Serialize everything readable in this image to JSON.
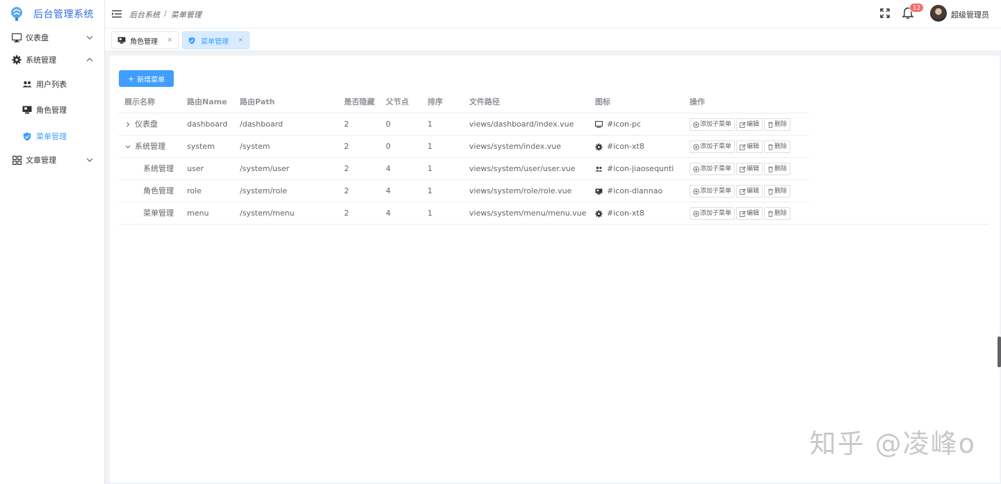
{
  "app": {
    "title": "后台管理系统"
  },
  "sidebar": {
    "items": [
      {
        "label": "仪表盘",
        "icon": "monitor-icon"
      },
      {
        "label": "系统管理",
        "icon": "gear-icon"
      },
      {
        "label": "文章管理",
        "icon": "grid-icon"
      }
    ],
    "subitems": [
      {
        "label": "用户列表",
        "icon": "users-icon"
      },
      {
        "label": "角色管理",
        "icon": "computer-icon"
      },
      {
        "label": "菜单管理",
        "icon": "shield-icon",
        "active": true
      }
    ]
  },
  "header": {
    "breadcrumb": [
      "后台系统",
      "菜单管理"
    ],
    "breadcrumb_sep": "/",
    "notification_count": "12",
    "username": "超级管理员"
  },
  "tabs": [
    {
      "label": "角色管理",
      "close": "×"
    },
    {
      "label": "菜单管理",
      "close": "×",
      "active": true
    }
  ],
  "toolbar": {
    "add_label": "新增菜单",
    "add_icon": "+"
  },
  "table": {
    "headers": [
      "展示名称",
      "路由Name",
      "路由Path",
      "是否隐藏",
      "父节点",
      "排序",
      "文件路径",
      "图标",
      "操作"
    ],
    "rows": [
      {
        "name": "仪表盘",
        "route_name": "dashboard",
        "path": "/dashboard",
        "hidden": "2",
        "parent": "0",
        "sort": "1",
        "file": "views/dashboard/index.vue",
        "icon": "#icon-pc",
        "icon_type": "monitor-icon"
      },
      {
        "name": "系统管理",
        "route_name": "system",
        "path": "/system",
        "hidden": "2",
        "parent": "0",
        "sort": "1",
        "file": "views/system/index.vue",
        "icon": "#icon-xt8",
        "icon_type": "gear-icon"
      },
      {
        "name": "系统管理",
        "route_name": "user",
        "path": "/system/user",
        "hidden": "2",
        "parent": "4",
        "sort": "1",
        "file": "views/system/user/user.vue",
        "icon": "#icon-jiaosequnti",
        "icon_type": "users-icon"
      },
      {
        "name": "角色管理",
        "route_name": "role",
        "path": "/system/role",
        "hidden": "2",
        "parent": "4",
        "sort": "1",
        "file": "views/system/role/role.vue",
        "icon": "#icon-diannao",
        "icon_type": "computer-icon"
      },
      {
        "name": "菜单管理",
        "route_name": "menu",
        "path": "/system/menu",
        "hidden": "2",
        "parent": "4",
        "sort": "1",
        "file": "views/system/menu/menu.vue",
        "icon": "#icon-xt8",
        "icon_type": "gear-icon"
      }
    ],
    "ops": {
      "add_child": "添加子菜单",
      "edit": "编辑",
      "delete": "删除"
    }
  },
  "watermark": "知乎 @凌峰o",
  "colors": {
    "primary": "#409eff",
    "brand": "#2f6fe0",
    "badge": "#f56c6c"
  }
}
